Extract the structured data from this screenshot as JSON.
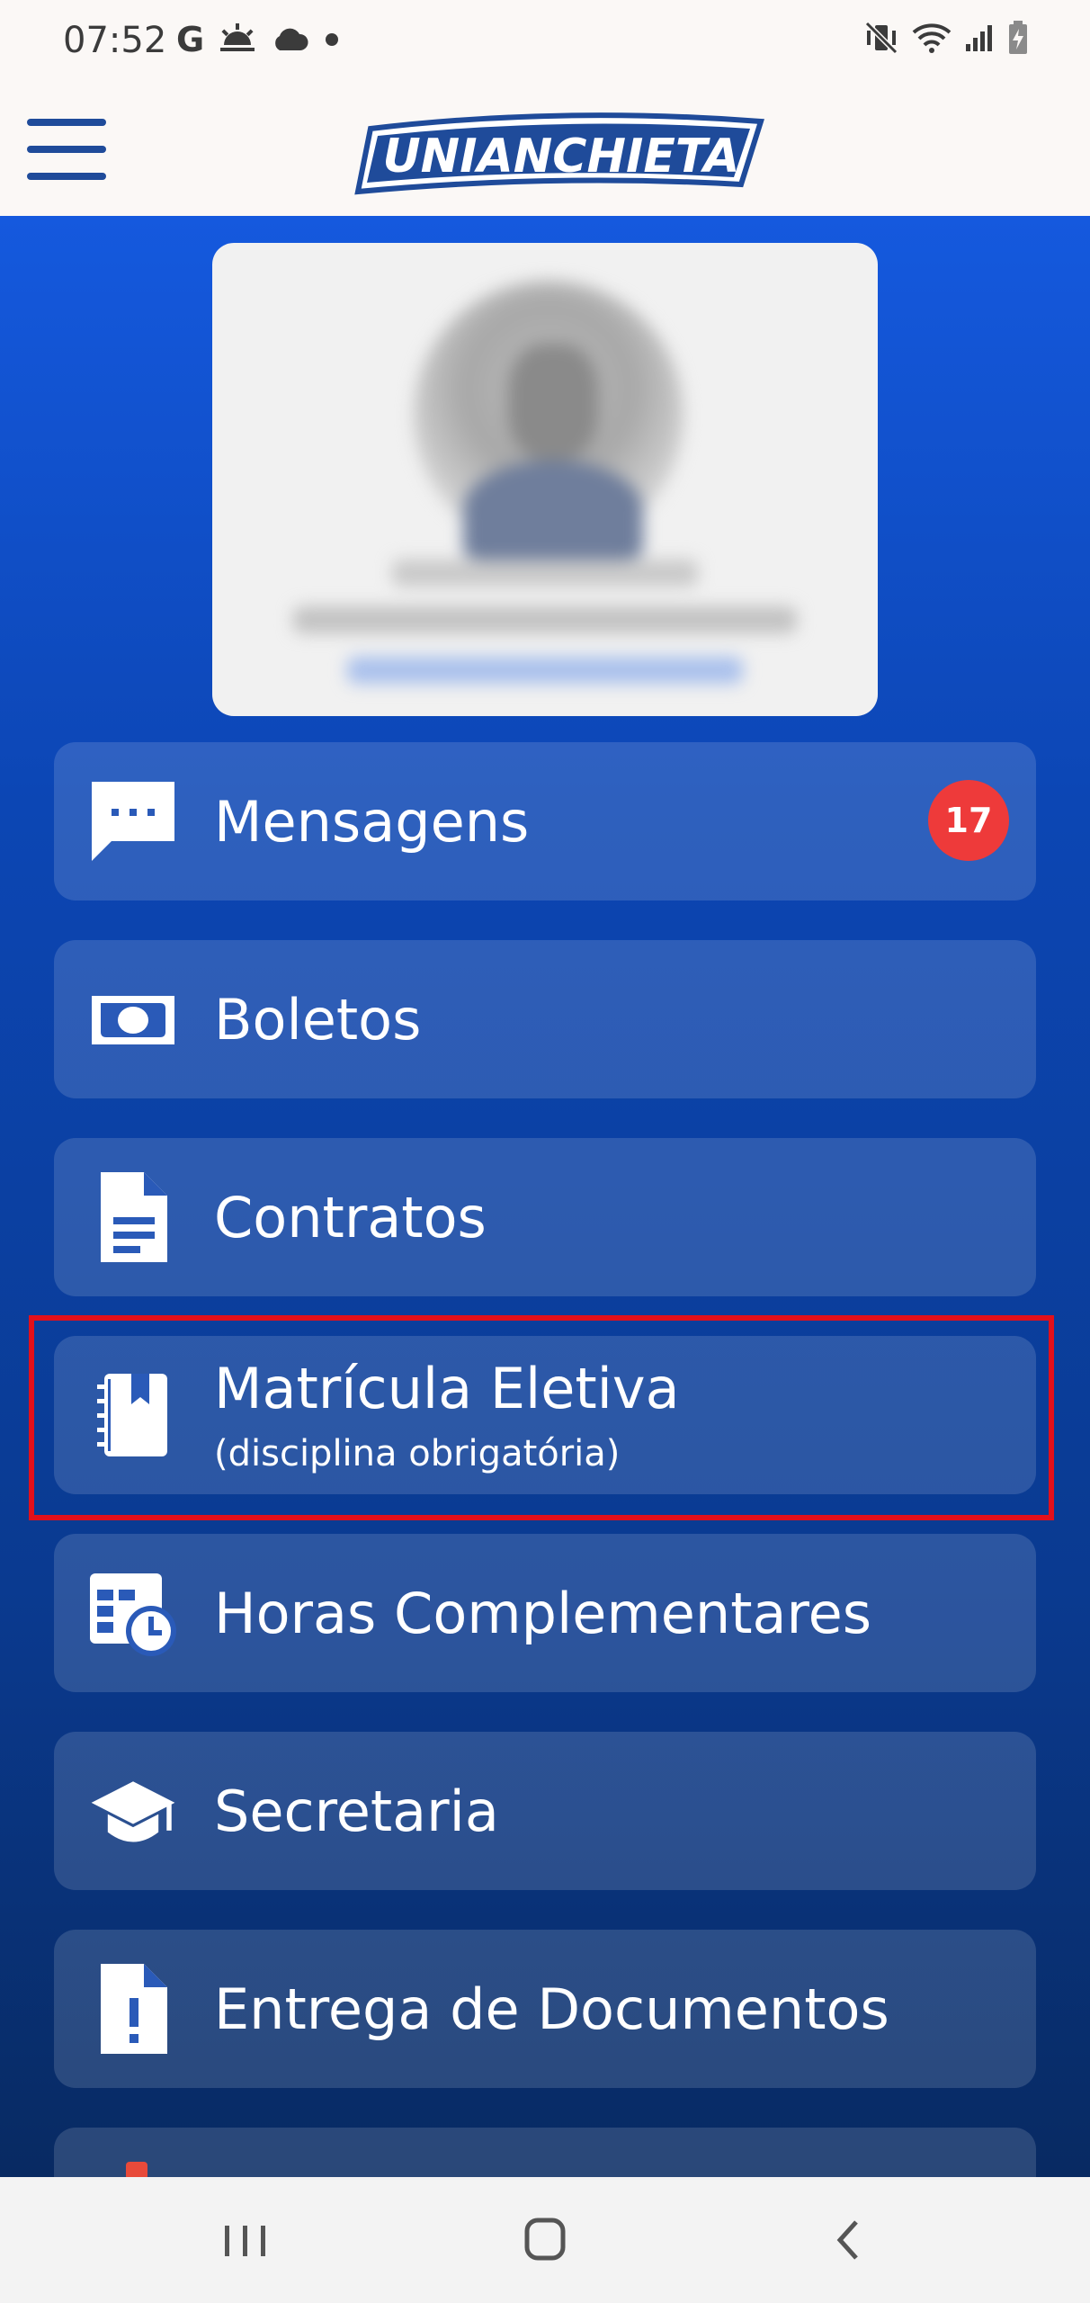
{
  "status_bar": {
    "time": "07:52",
    "left_icons": [
      "google-icon",
      "weather-sunrise-icon",
      "cloud-icon",
      "notification-dot-icon"
    ],
    "right_icons": [
      "vibrate-mute-icon",
      "wifi-icon",
      "signal-icon",
      "battery-charging-icon"
    ]
  },
  "header": {
    "logo_text": "UNIANCHIETA",
    "menu_icon": "hamburger-icon",
    "brand_color": "#1f4b9a"
  },
  "profile": {
    "blurred": true
  },
  "menu": {
    "items": [
      {
        "id": "mensagens",
        "label": "Mensagens",
        "icon": "message-icon",
        "badge": "17"
      },
      {
        "id": "boletos",
        "label": "Boletos",
        "icon": "money-icon"
      },
      {
        "id": "contratos",
        "label": "Contratos",
        "icon": "document-icon"
      },
      {
        "id": "matricula",
        "label": "Matrícula Eletiva",
        "sublabel": "(disciplina obrigatória)",
        "icon": "notebook-icon",
        "highlighted": true
      },
      {
        "id": "horas",
        "label": "Horas Complementares",
        "icon": "schedule-clock-icon"
      },
      {
        "id": "secretaria",
        "label": "Secretaria",
        "icon": "graduation-cap-icon"
      },
      {
        "id": "documentos",
        "label": "Entrega de Documentos",
        "icon": "document-alert-icon"
      }
    ]
  },
  "colors": {
    "gradient_top": "#1559de",
    "gradient_bottom": "#082a62",
    "badge": "#ee3a3a",
    "highlight": "#e3101a"
  },
  "nav_bar": {
    "buttons": [
      "recent-apps-icon",
      "home-icon",
      "back-icon"
    ]
  }
}
